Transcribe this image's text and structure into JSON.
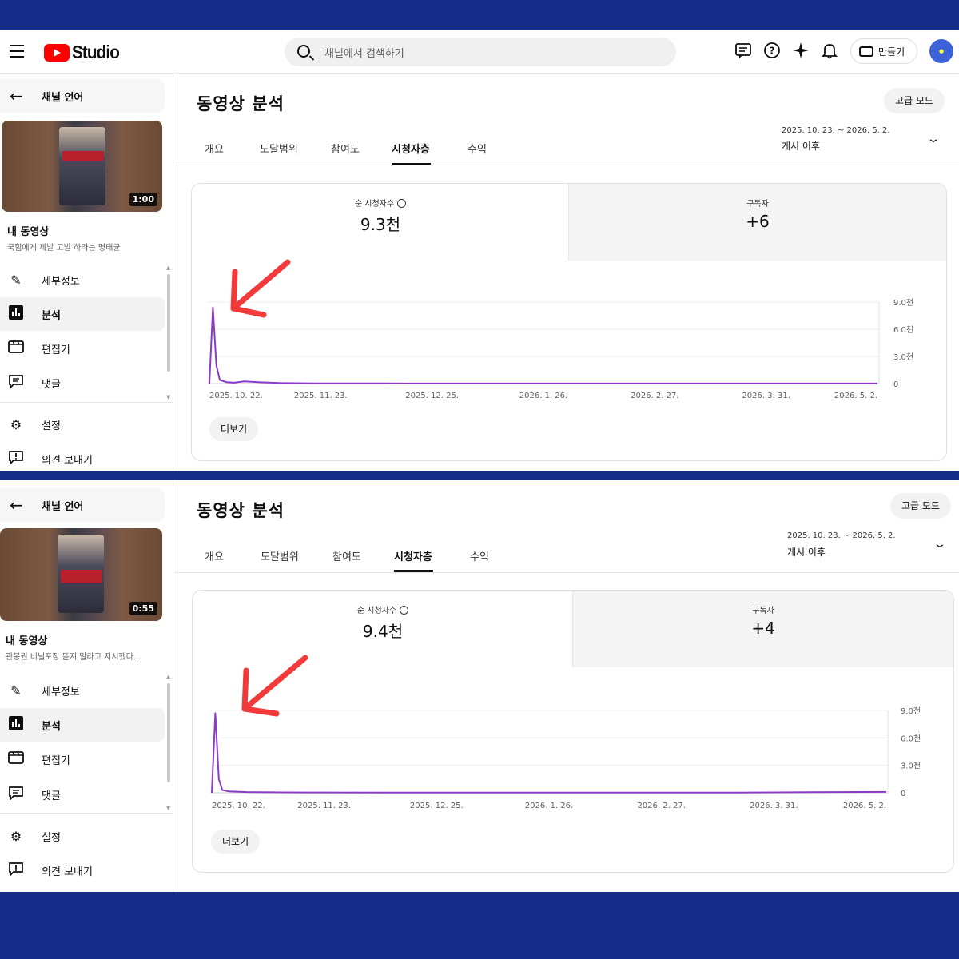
{
  "colors": {
    "frame_bg": "#172b8a",
    "series": "#8a3cc8",
    "annotation_arrow": "#f23a3a",
    "brand": "#ff0000"
  },
  "topbar": {
    "logo_text": "Studio",
    "search_placeholder": "채널에서 검색하기",
    "icons": [
      "menu-icon",
      "subtitles-icon",
      "help-icon",
      "sparkle-icon",
      "bell-icon",
      "create-video-icon"
    ],
    "create_label": "만들기"
  },
  "panels": [
    {
      "sidebar": {
        "back_label": "채널 언어",
        "thumbnail_duration": "1:00",
        "my_video_label": "내 동영상",
        "video_title": "국힘에게 제발 고발 하라는 명태균",
        "nav": [
          {
            "label": "세부정보",
            "icon": "pencil-icon",
            "active": false
          },
          {
            "label": "분석",
            "icon": "analytics-icon",
            "active": true
          },
          {
            "label": "편집기",
            "icon": "clapperboard-icon",
            "active": false
          },
          {
            "label": "댓글",
            "icon": "comment-icon",
            "active": false
          }
        ],
        "bottom_nav": [
          {
            "label": "설정",
            "icon": "gear-icon"
          },
          {
            "label": "의견 보내기",
            "icon": "feedback-icon"
          }
        ]
      },
      "main": {
        "title": "동영상 분석",
        "advanced_mode_label": "고급 모드",
        "tabs": [
          "개요",
          "도달범위",
          "참여도",
          "시청자층",
          "수익"
        ],
        "active_tab": "시청자층",
        "date_range": "2025. 10. 23. ~ 2026. 5. 2.",
        "date_label": "게시 이후",
        "metrics": [
          {
            "label": "순 시청자수",
            "value": "9.3천"
          },
          {
            "label": "구독자",
            "value": "+6"
          }
        ],
        "more_label": "더보기"
      },
      "chart_data": {
        "type": "line",
        "x_tick_labels": [
          "2025. 10. 22.",
          "2025. 11. 23.",
          "2025. 12. 25.",
          "2026. 1. 26.",
          "2026. 2. 27.",
          "2026. 3. 31.",
          "2026. 5. 2."
        ],
        "y_tick_labels": [
          "9.0천",
          "6.0천",
          "3.0천",
          "0"
        ],
        "y_ticks": [
          9000,
          6000,
          3000,
          0
        ],
        "ylim": [
          0,
          9000
        ],
        "x_days": [
          0,
          1,
          2,
          3,
          5,
          7,
          10,
          14,
          20,
          30,
          50,
          100,
          150,
          192
        ],
        "values": [
          0,
          8400,
          2000,
          400,
          150,
          100,
          250,
          150,
          60,
          30,
          20,
          10,
          10,
          5
        ]
      }
    },
    {
      "sidebar": {
        "back_label": "채널 언어",
        "thumbnail_duration": "0:55",
        "my_video_label": "내 동영상",
        "video_title": "관봉권 비닐포장 뜯지 말라고 지시했다...",
        "nav": [
          {
            "label": "세부정보",
            "icon": "pencil-icon",
            "active": false
          },
          {
            "label": "분석",
            "icon": "analytics-icon",
            "active": true
          },
          {
            "label": "편집기",
            "icon": "clapperboard-icon",
            "active": false
          },
          {
            "label": "댓글",
            "icon": "comment-icon",
            "active": false
          }
        ],
        "bottom_nav": [
          {
            "label": "설정",
            "icon": "gear-icon"
          },
          {
            "label": "의견 보내기",
            "icon": "feedback-icon"
          }
        ]
      },
      "main": {
        "title": "동영상 분석",
        "advanced_mode_label": "고급 모드",
        "tabs": [
          "개요",
          "도달범위",
          "참여도",
          "시청자층",
          "수익"
        ],
        "active_tab": "시청자층",
        "date_range": "2025. 10. 23. ~ 2026. 5. 2.",
        "date_label": "게시 이후",
        "metrics": [
          {
            "label": "순 시청자수",
            "value": "9.4천"
          },
          {
            "label": "구독자",
            "value": "+4"
          }
        ],
        "more_label": "더보기"
      },
      "chart_data": {
        "type": "line",
        "x_tick_labels": [
          "2025. 10. 22.",
          "2025. 11. 23.",
          "2025. 12. 25.",
          "2026. 1. 26.",
          "2026. 2. 27.",
          "2026. 3. 31.",
          "2026. 5. 2."
        ],
        "y_tick_labels": [
          "9.0천",
          "6.0천",
          "3.0천",
          "0"
        ],
        "y_ticks": [
          9000,
          6000,
          3000,
          0
        ],
        "ylim": [
          0,
          9000
        ],
        "x_days": [
          0,
          1,
          2,
          3,
          5,
          10,
          20,
          50,
          100,
          150,
          192
        ],
        "values": [
          0,
          8700,
          1500,
          300,
          150,
          80,
          40,
          20,
          20,
          30,
          100
        ]
      }
    }
  ]
}
